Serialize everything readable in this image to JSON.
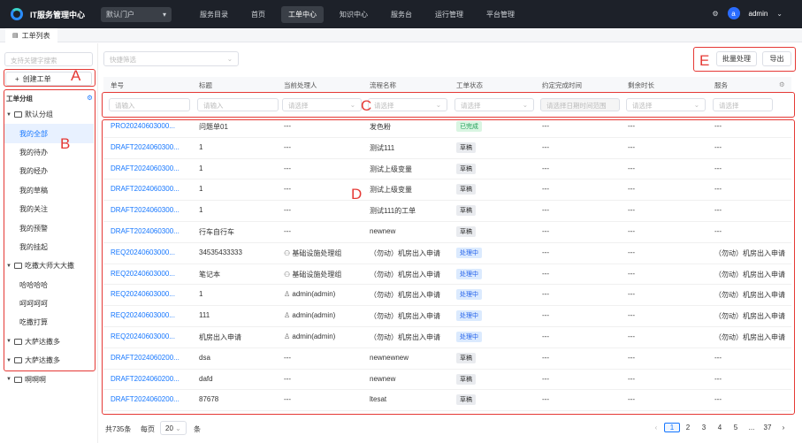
{
  "app": {
    "title": "IT服务管理中心",
    "portal": "默认门户",
    "user": "admin",
    "avatar_letter": "a"
  },
  "nav": [
    "服务目录",
    "首页",
    "工单中心",
    "知识中心",
    "服务台",
    "运行管理",
    "平台管理"
  ],
  "tab": {
    "label": "工单列表"
  },
  "sidebar": {
    "search_placeholder": "支持关键字搜索",
    "create_label": "创建工单",
    "group_header": "工单分组",
    "tree": [
      {
        "type": "group",
        "label": "默认分组"
      },
      {
        "type": "leaf",
        "label": "我的全部",
        "selected": true
      },
      {
        "type": "leaf",
        "label": "我的待办"
      },
      {
        "type": "leaf",
        "label": "我的经办"
      },
      {
        "type": "leaf",
        "label": "我的草稿"
      },
      {
        "type": "leaf",
        "label": "我的关注"
      },
      {
        "type": "leaf",
        "label": "我的预警"
      },
      {
        "type": "leaf",
        "label": "我的挂起"
      },
      {
        "type": "group",
        "label": "吃撒大师大大撒"
      },
      {
        "type": "leaf",
        "label": "哈哈哈哈"
      },
      {
        "type": "leaf",
        "label": "呵呵呵呵"
      },
      {
        "type": "leaf",
        "label": "吃撒打算"
      },
      {
        "type": "group",
        "label": "大萨达撒多"
      },
      {
        "type": "group",
        "label": "大萨达撒多"
      },
      {
        "type": "group",
        "label": "啊啊啊"
      }
    ]
  },
  "toolbar": {
    "filter_placeholder": "快捷筛选",
    "batch_label": "批量处理",
    "export_label": "导出"
  },
  "table": {
    "columns": [
      "单号",
      "标题",
      "当前处理人",
      "流程名称",
      "工单状态",
      "约定完成时间",
      "剩余时长",
      "服务"
    ],
    "filters": [
      "请输入",
      "请输入",
      "请选择",
      "请选择",
      "请选择",
      "请选择日期时间范围",
      "请选择",
      "请选择"
    ],
    "rows": [
      [
        "PRO20240603000...",
        "问题单01",
        "---",
        "发色粉",
        "已完成",
        "---",
        "---",
        "---"
      ],
      [
        "DRAFT2024060300...",
        "1",
        "---",
        "测试111",
        "草稿",
        "---",
        "---",
        "---"
      ],
      [
        "DRAFT2024060300...",
        "1",
        "---",
        "测试上级变量",
        "草稿",
        "---",
        "---",
        "---"
      ],
      [
        "DRAFT2024060300...",
        "1",
        "---",
        "测试上级变量",
        "草稿",
        "---",
        "---",
        "---"
      ],
      [
        "DRAFT2024060300...",
        "1",
        "---",
        "测试111的工单",
        "草稿",
        "---",
        "---",
        "---"
      ],
      [
        "DRAFT2024060300...",
        "行车自行车",
        "---",
        "newnew",
        "草稿",
        "---",
        "---",
        "---"
      ],
      [
        "REQ20240603000...",
        "34535433333",
        "基础设施处理组",
        "（勿动）机房出入申请",
        "处理中",
        "---",
        "---",
        "（勿动）机房出入申请"
      ],
      [
        "REQ20240603000...",
        "笔记本",
        "基础设施处理组",
        "（勿动）机房出入申请",
        "处理中",
        "---",
        "---",
        "（勿动）机房出入申请"
      ],
      [
        "REQ20240603000...",
        "1",
        "admin(admin)",
        "（勿动）机房出入申请",
        "处理中",
        "---",
        "---",
        "（勿动）机房出入申请"
      ],
      [
        "REQ20240603000...",
        "111",
        "admin(admin)",
        "（勿动）机房出入申请",
        "处理中",
        "---",
        "---",
        "（勿动）机房出入申请"
      ],
      [
        "REQ20240603000...",
        "机房出入申请",
        "admin(admin)",
        "（勿动）机房出入申请",
        "处理中",
        "---",
        "---",
        "（勿动）机房出入申请"
      ],
      [
        "DRAFT2024060200...",
        "dsa",
        "---",
        "newnewnew",
        "草稿",
        "---",
        "---",
        "---"
      ],
      [
        "DRAFT2024060200...",
        "dafd",
        "---",
        "newnew",
        "草稿",
        "---",
        "---",
        "---"
      ],
      [
        "DRAFT2024060200...",
        "87678",
        "---",
        "ltesat",
        "草稿",
        "---",
        "---",
        "---"
      ]
    ]
  },
  "footer": {
    "total": "共735条",
    "per_page_label": "每页",
    "per_page": "20",
    "unit": "条",
    "pages": [
      "1",
      "2",
      "3",
      "4",
      "5",
      "...",
      "37"
    ],
    "current": "1"
  },
  "annotations": [
    "A",
    "B",
    "C",
    "D",
    "E"
  ],
  "colors": {
    "accent": "#1677ff",
    "annotation": "#e53935",
    "topbar": "#1d2129"
  }
}
